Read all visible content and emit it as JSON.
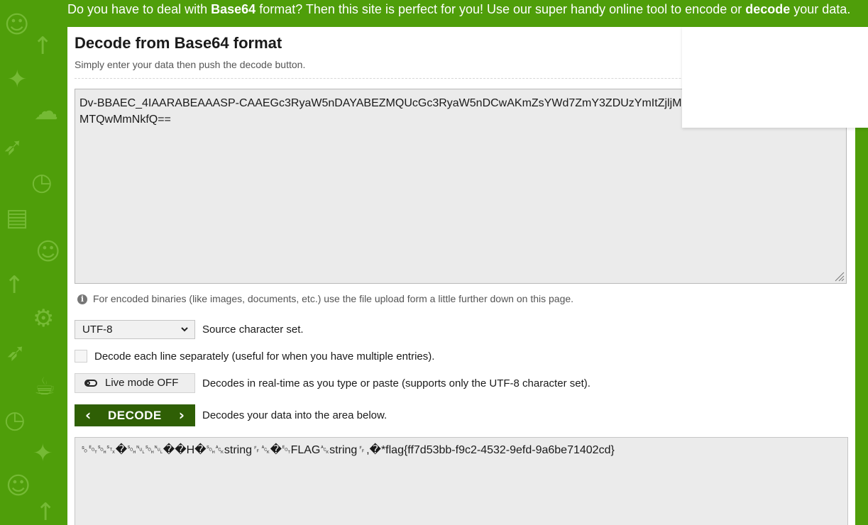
{
  "banner": {
    "part1": "Do you have to deal with ",
    "bold1": "Base64",
    "part2": " format? Then this site is perfect for you! Use our super handy online tool to encode or ",
    "bold2": "decode",
    "part3": " your data."
  },
  "decoder": {
    "title": "Decode from Base64 format",
    "subtitle": "Simply enter your data then push the decode button.",
    "input_value": "Dv-BBAEC_4IAARABEAAASP-CAAEGc3RyaW5nDAYABEZMQUcGc3RyaW5nDCwAKmZsYWd7ZmY3ZDUzYmItZjljMi00NTMyLTllZmQtOWE2YmU3MTQwMmNkfQ==",
    "info_text": "For encoded binaries (like images, documents, etc.) use the file upload form a little further down on this page.",
    "charset_value": "UTF-8",
    "charset_label": "Source character set.",
    "decode_each_line_label": "Decode each line separately (useful for when you have multiple entries).",
    "live_mode_label": "Live mode OFF",
    "live_mode_description": "Decodes in real-time as you type or paste (supports only the UTF-8 character set).",
    "decode_button_label": "DECODE",
    "decode_description": "Decodes your data into the area below.",
    "output_value": "␎␄␁␂�␁␀␁␀��H�␁␆string␌␆�␄FLAG␆string␌,�*flag{ff7d53bb-f9c2-4532-9efd-9a6be71402cd}"
  },
  "colors": {
    "brand_green": "#4f9e0a",
    "button_dark_green": "#2f5f05",
    "field_background": "#ebebeb"
  },
  "icons": {
    "info": "info-circle-icon",
    "select_caret": "chevron-down-icon",
    "toggle": "toggle-off-icon",
    "decode_left": "chevron-left-icon",
    "decode_right": "chevron-right-icon",
    "resize": "resize-grip-icon"
  }
}
